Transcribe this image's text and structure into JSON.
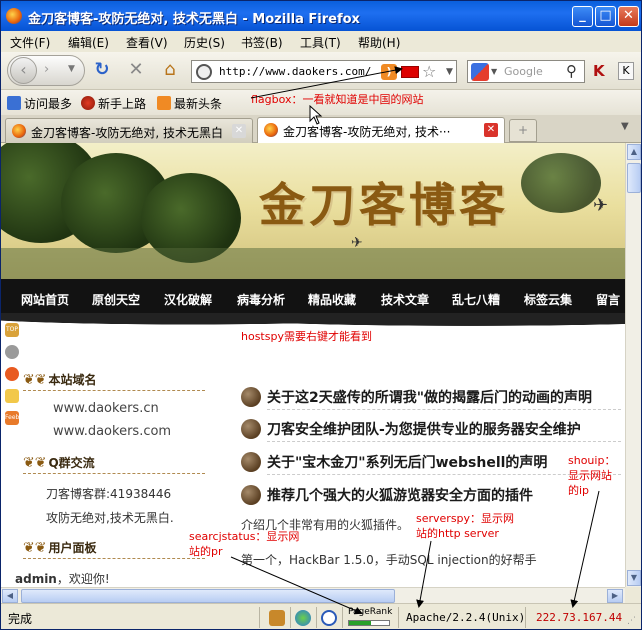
{
  "window": {
    "title": "金刀客博客-攻防无绝对, 技术无黑白 - Mozilla Firefox",
    "btn_min": "_",
    "btn_max": "□",
    "btn_close": "✕"
  },
  "menu": [
    "文件(F)",
    "编辑(E)",
    "查看(V)",
    "历史(S)",
    "书签(B)",
    "工具(T)",
    "帮助(H)"
  ],
  "address": {
    "url": "http://www.daokers.com/",
    "rss_glyph": ")",
    "star_glyph": "☆"
  },
  "search": {
    "placeholder": "Google",
    "mag_glyph": "⚲"
  },
  "toolbar_right": {
    "k1": "K",
    "k2": "K"
  },
  "bookmarks": [
    "访问最多",
    "新手上路",
    "最新头条"
  ],
  "tabs": [
    {
      "label": "金刀客博客-攻防无绝对, 技术无黑白",
      "active": false
    },
    {
      "label": "金刀客博客-攻防无绝对, 技术···",
      "active": true
    }
  ],
  "annotations": {
    "flagbox": "flagbox：一看就知道是中国的网站",
    "hostspy": "hostspy需要右键才能看到",
    "searchstatus_l1": "searcjstatus：显示网",
    "searchstatus_l2": "站的pr",
    "serverspy_l1": "serverspy：显示网",
    "serverspy_l2": "站的http server",
    "shouip_l1": "shouip：",
    "shouip_l2": "显示网站",
    "shouip_l3": "的ip"
  },
  "site": {
    "logo": "金刀客博客",
    "nav": [
      "网站首页",
      "原创天空",
      "汉化破解",
      "病毒分析",
      "精品收藏",
      "技术文章",
      "乱七八糟",
      "标签云集",
      "留言"
    ],
    "domain_heading": "本站域名",
    "domains": [
      "www.daokers.cn",
      "www.daokers.com"
    ],
    "qq_heading": "Q群交流",
    "qq_group": "刀客博客群:41938446",
    "motto": "攻防无绝对,技术无黑白.",
    "user_heading": "用户面板",
    "welcome_user": "admin",
    "welcome_rest": "，欢迎你!",
    "articles": [
      "关于这2天盛传的所谓我\"做的揭露后门的动画的声明",
      "刀客安全维护团队-为您提供专业的服务器安全维护",
      "关于\"宝木金刀\"系列无后门webshell的声明",
      "推荐几个强大的火狐游览器安全方面的插件"
    ],
    "intro": "介绍几个非常有用的火狐插件。",
    "item1": "第一个，HackBar  1.5.0，手动SQL injection的好帮手",
    "side_icons": [
      "TOP",
      "Feeb"
    ]
  },
  "status": {
    "text": "完成",
    "pagerank_label": "PageRank",
    "pagerank_value": 0.55,
    "server": "Apache/2.2.4(Unix)",
    "ip": "222.73.167.44"
  },
  "colors": {
    "annotation": "#e00000",
    "titlebar": "#0a5fdc",
    "ip": "#c00000"
  }
}
